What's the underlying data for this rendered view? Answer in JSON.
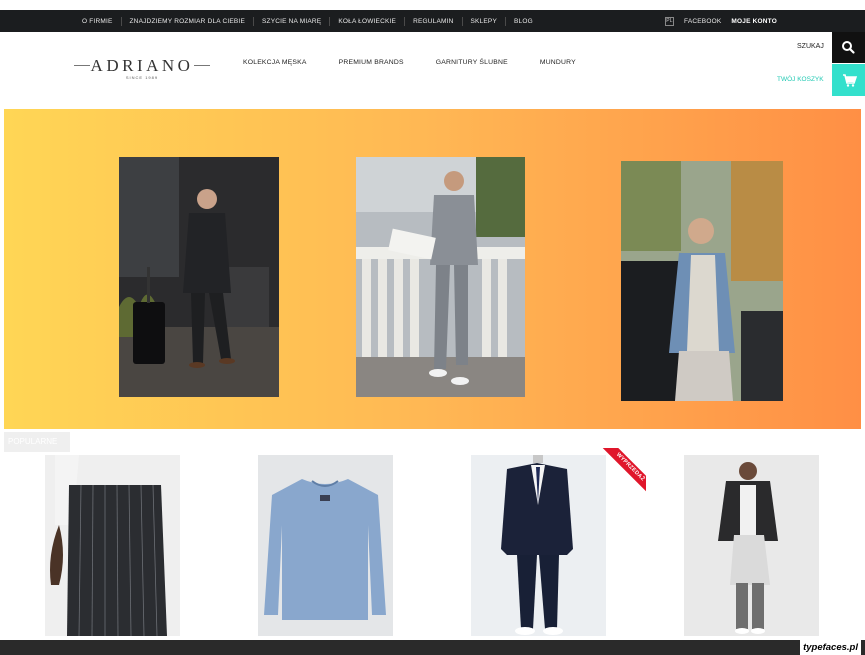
{
  "top_nav": {
    "links": [
      "O FIRMIE",
      "ZNAJDZIEMY ROZMIAR DLA CIEBIE",
      "SZYCIE NA MIARĘ",
      "KOŁA ŁOWIECKIE",
      "REGULAMIN",
      "SKLEPY",
      "BLOG"
    ],
    "language": "PL",
    "facebook": "FACEBOOK",
    "account": "MOJE KONTO"
  },
  "logo": {
    "name": "ADRIANO",
    "tagline": "SINCE 1989"
  },
  "main_nav": [
    "KOLEKCJA MĘSKA",
    "PREMIUM BRANDS",
    "GARNITURY ŚLUBNE",
    "MUNDURY"
  ],
  "header": {
    "search_label": "SZUKAJ",
    "cart_label": "TWÓJ KOSZYK"
  },
  "section": {
    "popular_label": "POPULARNE"
  },
  "products": [
    {
      "badge": ""
    },
    {
      "badge": ""
    },
    {
      "badge": "WYPRZEDAŻ"
    },
    {
      "badge": ""
    }
  ],
  "watermark": "typefaces.pl",
  "colors": {
    "accent": "#33e0cc",
    "accent_text": "#21c9b3",
    "sale": "#e0162b",
    "topbar": "#1b1d1f",
    "hero_start": "#ffd655",
    "hero_end": "#ff8f45"
  },
  "icons": {
    "search": "search-icon",
    "cart": "cart-icon"
  }
}
